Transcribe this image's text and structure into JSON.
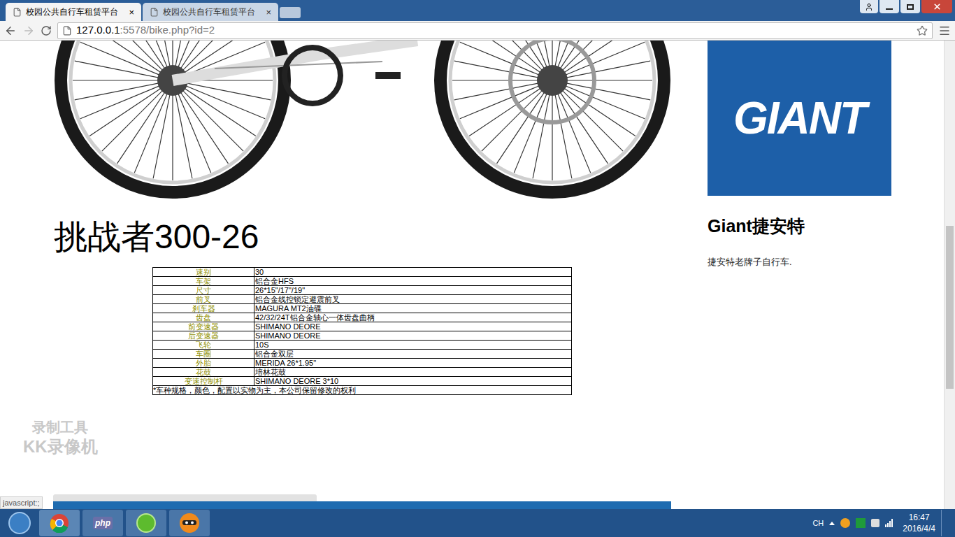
{
  "browser": {
    "tabs": [
      {
        "label": "校园公共自行车租赁平台",
        "selected": true,
        "close": "×"
      },
      {
        "label": "校园公共自行车租赁平台",
        "selected": false,
        "close": "×"
      }
    ],
    "address": {
      "host": "127.0.0.1",
      "rest": ":5578/bike.php?id=2"
    }
  },
  "page": {
    "bike_title": "挑战者300-26",
    "specs": [
      {
        "label": "速别",
        "value": "30"
      },
      {
        "label": "车架",
        "value": "铝合金HFS"
      },
      {
        "label": "尺寸",
        "value": "26*15\"/17\"/19\""
      },
      {
        "label": "前叉",
        "value": "铝合金线控锁定避震前叉"
      },
      {
        "label": "刹车器",
        "value": "MAGURA MT2油碟"
      },
      {
        "label": "齿盘",
        "value": "42/32/24T铝合金轴心一体齿盘曲柄"
      },
      {
        "label": "前变速器",
        "value": "SHIMANO DEORE"
      },
      {
        "label": "后变速器",
        "value": "SHIMANO DEORE"
      },
      {
        "label": "飞轮",
        "value": "10S"
      },
      {
        "label": "车圈",
        "value": "铝合金双层"
      },
      {
        "label": "外胎",
        "value": "MERIDA 26*1.95\""
      },
      {
        "label": "花鼓",
        "value": "培林花鼓"
      },
      {
        "label": "变速控制杆",
        "value": "SHIMANO DEORE 3*10"
      }
    ],
    "note": "*车种规格，颜色，配置以实物为主，本公司保留修改的权利",
    "brand": {
      "logo": "GIANT",
      "name": "Giant捷安特",
      "desc": "捷安特老牌子自行车."
    }
  },
  "watermark": [
    "录制工具",
    "KK录像机"
  ],
  "status_bubble": "javascript:;",
  "taskbar": {
    "php_label": "php",
    "lang": "CH",
    "time": "16:47",
    "date": "2016/4/4"
  }
}
